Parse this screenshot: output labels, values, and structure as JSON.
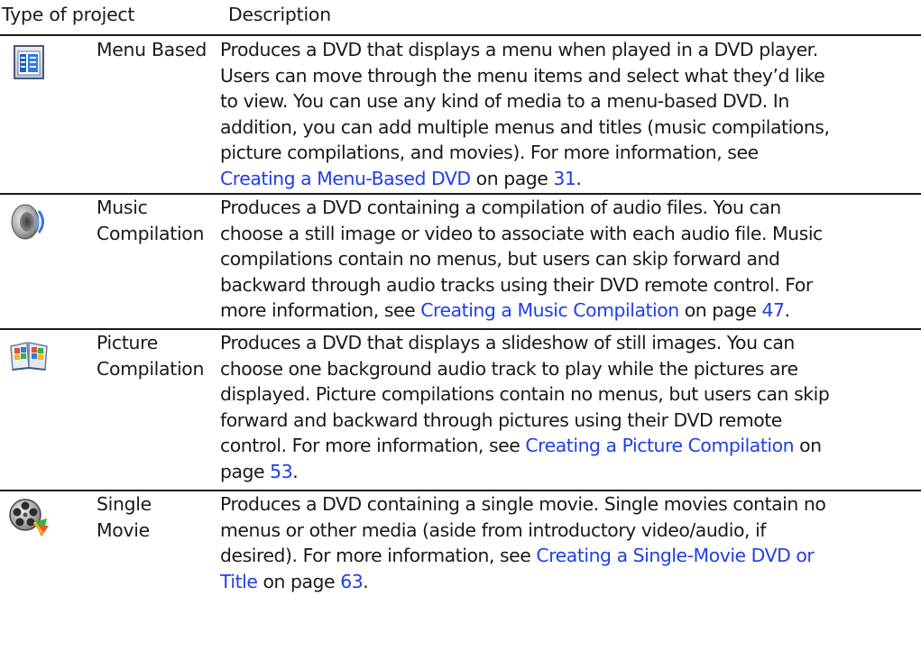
{
  "header": {
    "type_of_project": "Type of project",
    "description": "Description"
  },
  "rows": [
    {
      "icon": "menu-list-icon",
      "label_lines": [
        "Menu Based"
      ],
      "desc_lines": [
        [
          {
            "t": "Produces a DVD that displays a menu when played in a DVD player."
          }
        ],
        [
          {
            "t": "Users can move through the menu items and select what they’d like"
          }
        ],
        [
          {
            "t": "to view. You can use any kind of media to a menu-based DVD. In"
          }
        ],
        [
          {
            "t": "addition, you can add multiple menus and titles (music compilations,"
          }
        ],
        [
          {
            "t": "picture compilations, and movies). For more information, see"
          }
        ],
        [
          {
            "t": "Creating a Menu-Based DVD",
            "link": true
          },
          {
            "t": " on page "
          },
          {
            "t": "31",
            "link": true
          },
          {
            "t": "."
          }
        ]
      ]
    },
    {
      "icon": "speaker-icon",
      "label_lines": [
        "Music",
        "Compilation"
      ],
      "desc_lines": [
        [
          {
            "t": "Produces a DVD containing a compilation of audio files. You can"
          }
        ],
        [
          {
            "t": "choose a still image or video to associate with each audio file. Music"
          }
        ],
        [
          {
            "t": "compilations contain no menus, but users can skip forward and"
          }
        ],
        [
          {
            "t": "backward through audio tracks using their DVD remote control. For"
          }
        ],
        [
          {
            "t": "more information, see "
          },
          {
            "t": "Creating a Music Compilation",
            "link": true
          },
          {
            "t": " on page "
          },
          {
            "t": "47",
            "link": true
          },
          {
            "t": "."
          }
        ]
      ]
    },
    {
      "icon": "picture-book-icon",
      "label_lines": [
        "Picture",
        "Compilation"
      ],
      "desc_lines": [
        [
          {
            "t": "Produces a DVD that displays a slideshow of still images. You can"
          }
        ],
        [
          {
            "t": "choose one background audio track to play while the pictures are"
          }
        ],
        [
          {
            "t": "displayed. Picture compilations contain no menus, but users can skip"
          }
        ],
        [
          {
            "t": "forward and backward through pictures using their DVD remote"
          }
        ],
        [
          {
            "t": "control. For more information, see "
          },
          {
            "t": "Creating a Picture Compilation",
            "link": true
          },
          {
            "t": " on"
          }
        ],
        [
          {
            "t": "page "
          },
          {
            "t": "53",
            "link": true
          },
          {
            "t": "."
          }
        ]
      ]
    },
    {
      "icon": "film-reel-icon",
      "label_lines": [
        "Single",
        "Movie"
      ],
      "desc_lines": [
        [
          {
            "t": "Produces a DVD containing a single movie. Single movies contain no"
          }
        ],
        [
          {
            "t": "menus or other media (aside from introductory video/audio, if"
          }
        ],
        [
          {
            "t": "desired). For more information, see "
          },
          {
            "t": "Creating a Single-Movie DVD or",
            "link": true
          }
        ],
        [
          {
            "t": "Title",
            "link": true
          },
          {
            "t": " on page "
          },
          {
            "t": "63",
            "link": true
          },
          {
            "t": "."
          }
        ]
      ]
    }
  ]
}
